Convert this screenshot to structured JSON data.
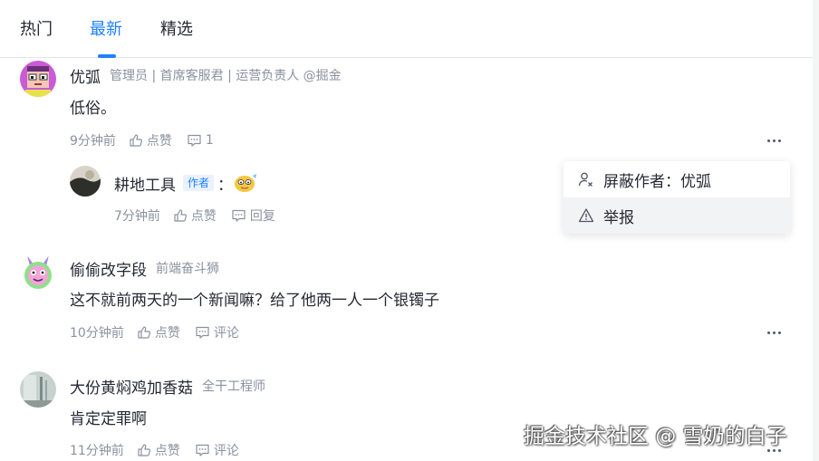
{
  "tabs": [
    {
      "label": "热门",
      "active": false
    },
    {
      "label": "最新",
      "active": true
    },
    {
      "label": "精选",
      "active": false
    }
  ],
  "comments": [
    {
      "name": "优弧",
      "title": "管理员 | 首席客服君 | 运营负责人 @掘金",
      "content": "低俗。",
      "time": "9分钟前",
      "like": "点赞",
      "comment": "1",
      "reply": {
        "name": "耕地工具",
        "badge": "作者",
        "colon": "：",
        "emoji": "emoji-sticker",
        "time": "7分钟前",
        "like": "点赞",
        "reply": "回复"
      }
    },
    {
      "name": "偷偷改字段",
      "title": "前端奋斗狮",
      "content": "这不就前两天的一个新闻嘛？给了他两一人一个银镯子",
      "time": "10分钟前",
      "like": "点赞",
      "comment": "评论"
    },
    {
      "name": "大份黄焖鸡加香菇",
      "title": "全干工程师",
      "content": "肯定定罪啊",
      "time": "11分钟前",
      "like": "点赞",
      "comment": "评论"
    }
  ],
  "menu": {
    "block": "屏蔽作者：优弧",
    "report": "举报"
  },
  "watermark": "掘金技术社区 @ 雪奶的白子",
  "colors": {
    "accent": "#1e80ff",
    "text": "#252933",
    "muted": "#8a919f"
  }
}
